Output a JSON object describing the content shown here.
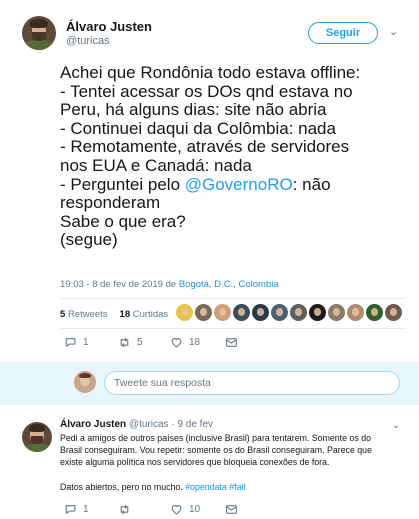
{
  "tweet": {
    "author_name": "Álvaro Justen",
    "author_handle": "@turicas",
    "follow_label": "Seguir",
    "text_lines": [
      "Achei que Rondônia todo estava offline:",
      "- Tentei acessar os DOs qnd estava no",
      "Peru, há alguns dias: site não abria",
      "- Continuei daqui da Colômbia: nada",
      "- Remotamente, através de servidores",
      "nos EUA e Canadá: nada",
      "- Perguntei pelo "
    ],
    "mention": "@GovernoRO",
    "after_mention": ": não",
    "text_tail": "responderam\nSabe o que era?\n(segue)",
    "timestamp": "19:03 - 8 de fev de 2019 de ",
    "location": "Bogotá, D.C., Colombia",
    "retweets_count": "5",
    "retweets_label": "Retweets",
    "likes_count": "18",
    "likes_label": "Curtidas",
    "liker_colors": [
      "#e8c44a",
      "#7a6a5a",
      "#c9a07e",
      "#3b4b5b",
      "#2b3a4a",
      "#4a5f70",
      "#5f5f5f",
      "#1e1e1e",
      "#8a7a6a",
      "#b08a6e",
      "#2f5f2f",
      "#6e5a4e"
    ],
    "replies_count": "1",
    "rt_count": "5",
    "like_count": "18"
  },
  "reply_box": {
    "placeholder": "Tweete sua resposta"
  },
  "reply": {
    "author_name": "Álvaro Justen",
    "author_handle": "@turicas",
    "date": "9 de fev",
    "text": "Pedi a amigos de outros países (inclusive Brasil) para tentarem. Somente os do\nBrasil conseguiram. Vou repetir: somente os do Brasil conseguiram. Parece que\nexiste alguma política nos servidores que bloqueia conexões de fora.\n\nDatos abiertos, pero no mucho. ",
    "hashtags": [
      "#opendata",
      "#fail"
    ],
    "replies_count": "1",
    "rt_count": "",
    "like_count": "10"
  }
}
